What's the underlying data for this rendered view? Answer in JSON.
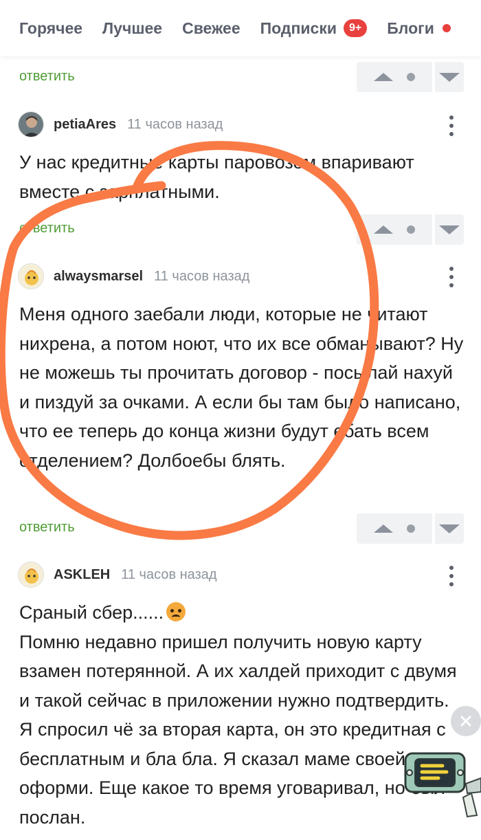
{
  "nav": {
    "tabs": [
      "Горячее",
      "Лучшее",
      "Свежее",
      "Подписки",
      "Блоги"
    ],
    "subscriptions_badge": "9+"
  },
  "reply_label": "ответить",
  "comments": [
    {
      "username": "petiaAres",
      "time": "11 часов назад",
      "text": "У нас кредитные карты паровозом впаривают вместе с зарплатными."
    },
    {
      "username": "alwaysmarsel",
      "time": "11 часов назад",
      "text": "Меня одного заебали люди, которые не читают нихрена, а потом ноют, что их все обманывают? Ну не можешь ты прочитать договор - посылай нахуй и пиздуй за очками. А если бы там было написано, что ее теперь до конца жизни будут ебать всем отделением? Долбоебы блять."
    },
    {
      "username": "ASKLEH",
      "time": "11 часов назад",
      "text_first": "Сраный сбер......",
      "text_rest": "Помню недавно пришел получить новую карту взамен потерянной. А их халдей приходит с двумя и такой сейчас в приложении нужно подтвердить. Я спросил чё за вторая карта, он это кредитная с бесплатным и бла бла. Я сказал маме своей оформи. Еще какое то время уговаривал, но был послан."
    }
  ],
  "icons": {
    "vote_up": "vote-up-icon",
    "vote_down": "vote-down-icon",
    "more": "more-vertical-icon",
    "close": "close-icon",
    "emoji": "angry-face-emoji"
  },
  "colors": {
    "reply_green": "#4f9c36",
    "badge_red": "#e8413e",
    "scribble_orange": "#f97a45",
    "vote_bg": "#f1f2f4"
  }
}
